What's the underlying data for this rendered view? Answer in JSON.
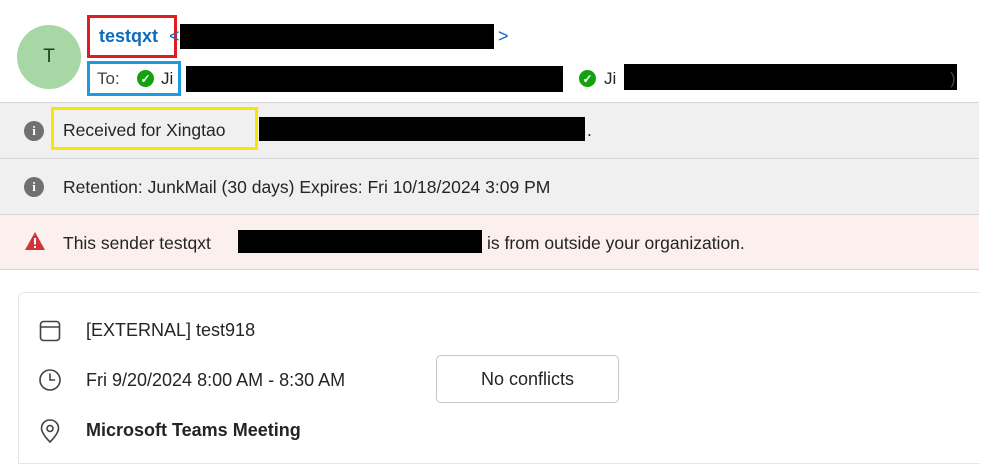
{
  "sender": {
    "avatar_initial": "T",
    "name": "testqxt",
    "angle_open": "<",
    "angle_close": ">"
  },
  "recipients": {
    "to_label": "To:",
    "first_partial": "Ji",
    "second_partial": "Ji",
    "trailing_paren": ")"
  },
  "banners": {
    "received_prefix": "Received for Xingtao",
    "received_suffix": ".",
    "retention": "Retention: JunkMail (30 days) Expires: Fri 10/18/2024 3:09 PM",
    "external_prefix": "This sender testqxt",
    "external_suffix": "is from outside your organization."
  },
  "meeting": {
    "subject": "[EXTERNAL] test918",
    "time": "Fri 9/20/2024 8:00 AM - 8:30 AM",
    "conflicts_button": "No conflicts",
    "location": "Microsoft Teams Meeting"
  },
  "colors": {
    "accent_link": "#0f6cbd",
    "avatar_bg": "#a7d7a4",
    "presence_green": "#13a10e",
    "warning_red": "#d13438",
    "annotation_red": "#e11b22",
    "annotation_blue": "#1e9ae0",
    "annotation_yellow": "#f7e600"
  },
  "icons": {
    "info": "info-icon",
    "warning": "warning-icon",
    "calendar": "calendar-icon",
    "clock": "clock-icon",
    "location": "location-pin-icon",
    "presence": "presence-available-icon"
  }
}
